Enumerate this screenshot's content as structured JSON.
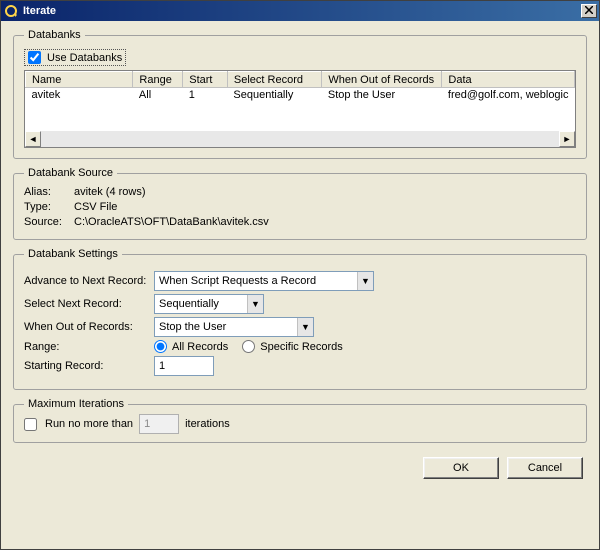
{
  "window": {
    "title": "Iterate"
  },
  "databanks": {
    "legend": "Databanks",
    "use_databanks_label": "Use Databanks",
    "use_databanks_checked": true,
    "columns": {
      "name": "Name",
      "range": "Range",
      "start": "Start",
      "select_record": "Select Record",
      "when_out": "When Out of Records",
      "data": "Data"
    },
    "rows": [
      {
        "name": "avitek",
        "range": "All",
        "start": "1",
        "select_record": "Sequentially",
        "when_out": "Stop the User",
        "data": "fred@golf.com, weblogic"
      }
    ]
  },
  "source": {
    "legend": "Databank Source",
    "alias_label": "Alias:",
    "alias_value": "avitek (4 rows)",
    "type_label": "Type:",
    "type_value": "CSV File",
    "source_label": "Source:",
    "source_value": "C:\\OracleATS\\OFT\\DataBank\\avitek.csv"
  },
  "settings": {
    "legend": "Databank Settings",
    "advance_label": "Advance to Next Record:",
    "advance_value": "When Script Requests a Record",
    "select_next_label": "Select Next Record:",
    "select_next_value": "Sequentially",
    "when_out_label": "When Out of Records:",
    "when_out_value": "Stop the User",
    "range_label": "Range:",
    "range_all_label": "All Records",
    "range_specific_label": "Specific Records",
    "starting_label": "Starting Record:",
    "starting_value": "1"
  },
  "max_iter": {
    "legend": "Maximum Iterations",
    "checkbox_label": "Run no more than",
    "value": "1",
    "suffix": "iterations"
  },
  "buttons": {
    "ok": "OK",
    "cancel": "Cancel"
  }
}
